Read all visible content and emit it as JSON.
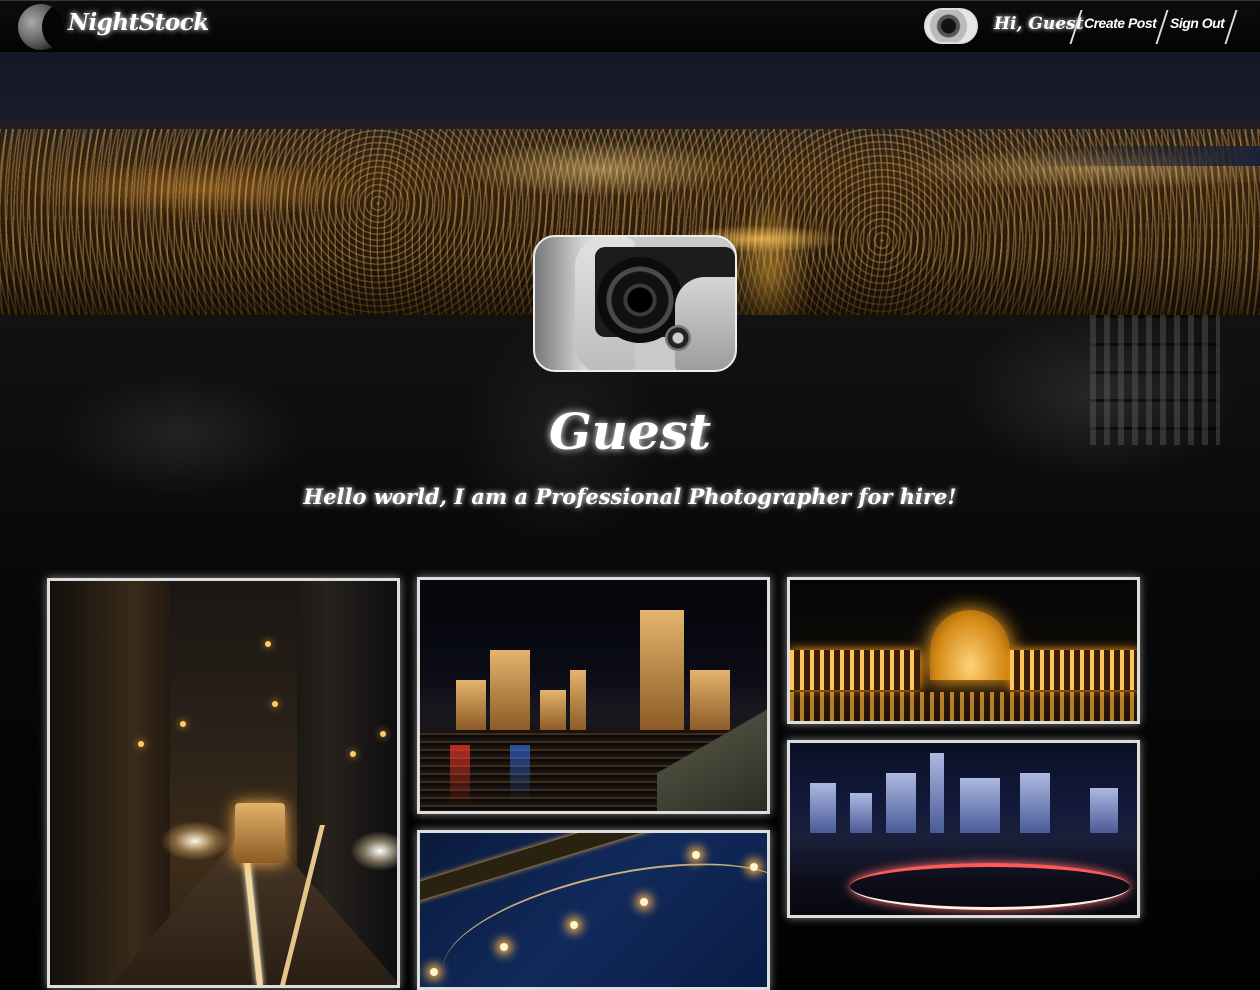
{
  "navbar": {
    "brand": "NightStock",
    "greeting": "Hi, Guest",
    "links": [
      "Create Post",
      "Sign Out"
    ]
  },
  "profile": {
    "name": "Guest",
    "bio": "Hello world, I am a Professional Photographer for hire!"
  },
  "gallery": {
    "photos": [
      "cable-car-street-photo",
      "ferry-building-photo",
      "palace-of-fine-arts-photo",
      "city-skyline-photo",
      "bay-bridge-photo"
    ]
  }
}
